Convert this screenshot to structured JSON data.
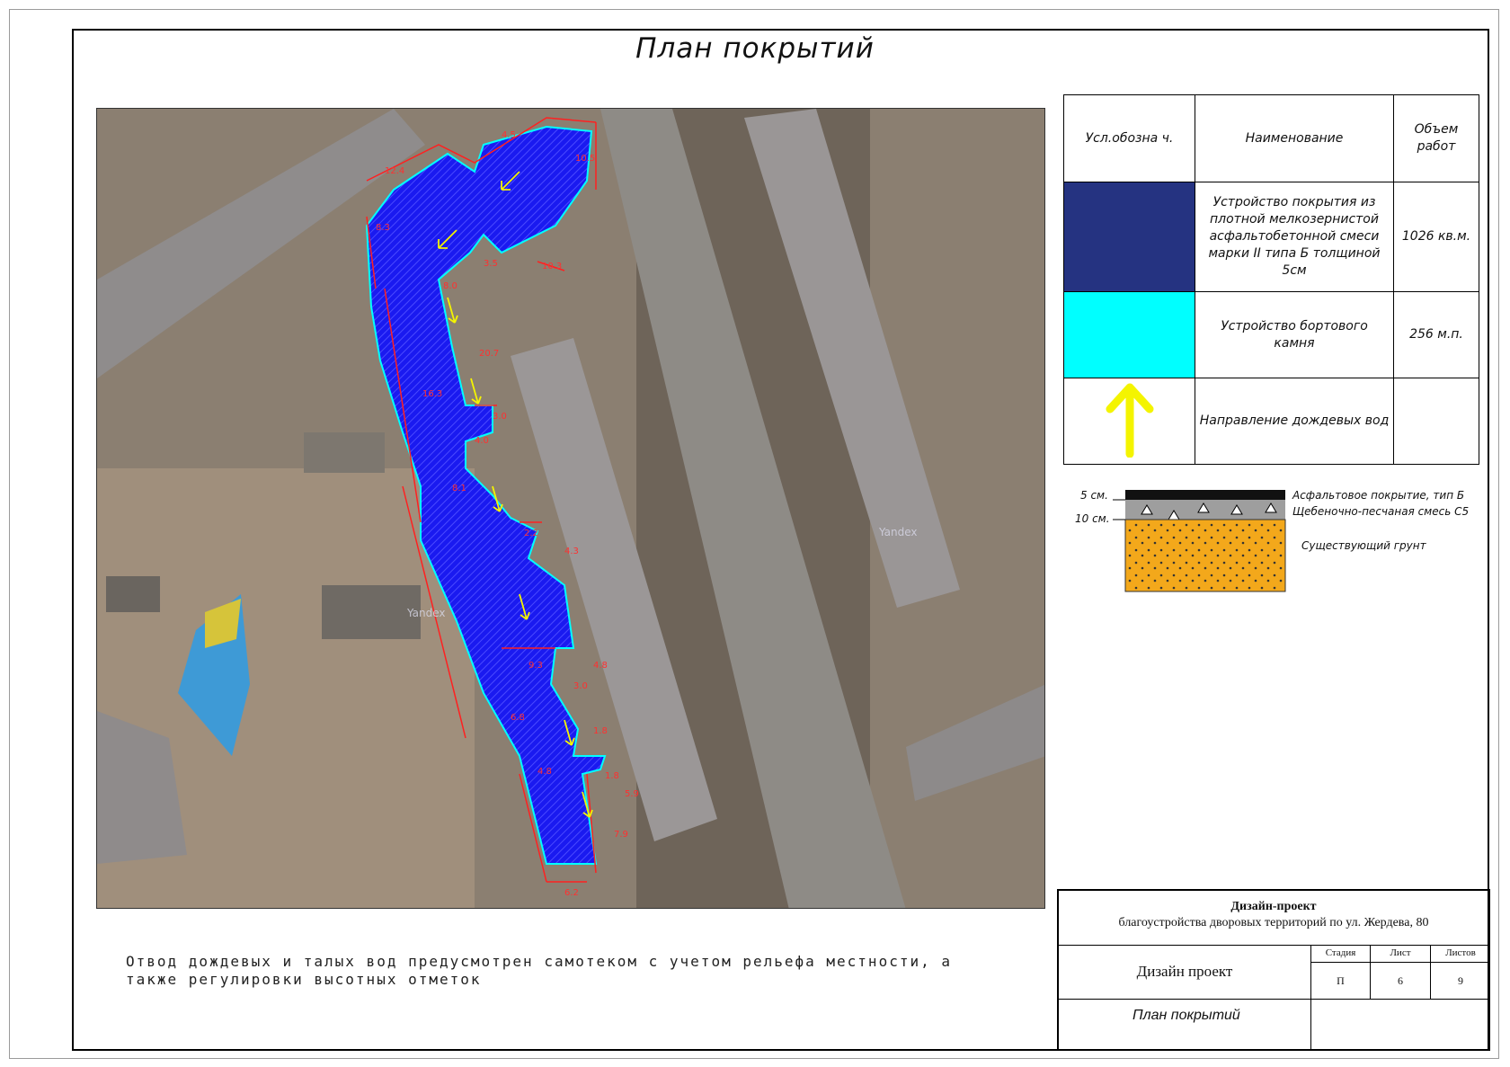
{
  "sheet": {
    "title": "План покрытий"
  },
  "legend": {
    "headers": {
      "symbol": "Усл.обозна ч.",
      "name": "Наименование",
      "volume": "Объем работ"
    },
    "rows": [
      {
        "color": "#253381",
        "name_lines": [
          "Устройство покрытия из",
          "плотной мелкозернистой",
          "асфальтобетонной смеси",
          "марки II типа Б толщиной",
          "5см"
        ],
        "volume": "1026 кв.м."
      },
      {
        "color": "#00ffff",
        "name_lines": [
          "Устройство бортового",
          "камня"
        ],
        "volume": "256 м.п."
      },
      {
        "icon": "arrow-up-icon",
        "icon_color": "#f4f400",
        "name_lines": [
          "Направление дождевых вод"
        ],
        "volume": ""
      }
    ]
  },
  "layers": {
    "thickness_top": "5 см.",
    "thickness_mid": "10 см.",
    "top": "Асфальтовое покрытие, тип Б",
    "middle": "Щебеночно-песчаная смесь С5",
    "bottom": "Существующий грунт"
  },
  "photo": {
    "watermark": "Yandex",
    "dimensions": [
      "12.4",
      "4.5",
      "10.5",
      "10.3",
      "8.3",
      "3.5",
      "8.0",
      "20.7",
      "3.0",
      "4.0",
      "8.1",
      "2.2",
      "4.3",
      "16.3",
      "9.3",
      "4.8",
      "6.8",
      "3.0",
      "1.8",
      "1.8",
      "4.8",
      "5.9",
      "7.9",
      "6.2"
    ]
  },
  "note": {
    "lines": [
      "Отвод дождевых и талых вод предусмотрен самотеком с учетом рельефа местности, а",
      "также регулировки высотных отметок"
    ]
  },
  "stamp": {
    "title": "Дизайн-проект",
    "subtitle": "благоустройства дворовых территорий по ул. Жердева, 80",
    "doc_name": "Дизайн проект",
    "stage_label": "Стадия",
    "stage": "П",
    "sheet_label": "Лист",
    "sheet_no": "6",
    "sheets_label": "Листов",
    "sheets_total": "9",
    "sheet_name": "План покрытий"
  }
}
